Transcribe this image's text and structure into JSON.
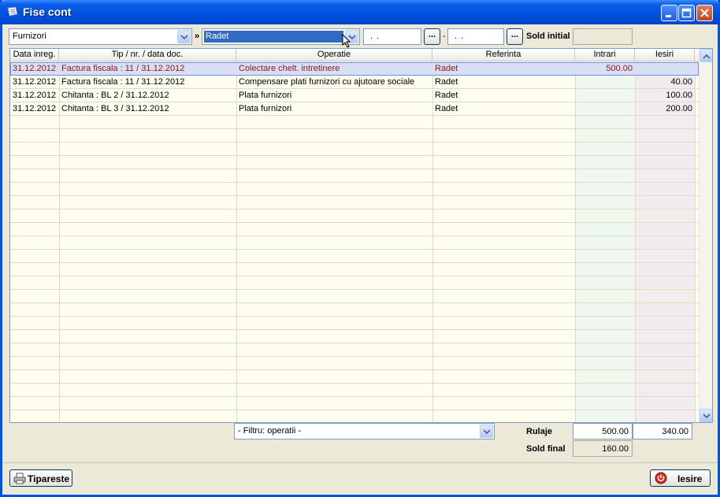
{
  "window": {
    "title": "Fise cont"
  },
  "filters": {
    "account_type": "Furnizori",
    "separator": "»",
    "partner": "Radet",
    "date_from": ". .",
    "date_to": ". .",
    "date_dash": "-",
    "date_btn": "...",
    "sold_initial_label": "Sold initial",
    "sold_initial_value": ""
  },
  "grid": {
    "columns": [
      "Data inreg.",
      "Tip / nr. / data doc.",
      "Operatie",
      "Referinta",
      "Intrari",
      "Iesiri"
    ],
    "rows": [
      {
        "date": "31.12.2012",
        "doc": "Factura fiscala : 11 / 31.12.2012",
        "op": "Colectare chelt. intretinere",
        "ref": "Radet",
        "in": "500.00",
        "out": ""
      },
      {
        "date": "31.12.2012",
        "doc": "Factura fiscala : 11 / 31.12.2012",
        "op": "Compensare plati furnizori cu ajutoare sociale",
        "ref": "Radet",
        "in": "",
        "out": "40.00"
      },
      {
        "date": "31.12.2012",
        "doc": "Chitanta : BL 2 / 31.12.2012",
        "op": "Plata furnizori",
        "ref": "Radet",
        "in": "",
        "out": "100.00"
      },
      {
        "date": "31.12.2012",
        "doc": "Chitanta : BL 3 / 31.12.2012",
        "op": "Plata furnizori",
        "ref": "Radet",
        "in": "",
        "out": "200.00"
      }
    ]
  },
  "footer": {
    "filter_combo": "- Filtru: operatii -",
    "rulaje_label": "Rulaje",
    "rulaje_in": "500.00",
    "rulaje_out": "340.00",
    "sold_final_label": "Sold final",
    "sold_final_value": "160.00",
    "print_label": "Tipareste",
    "exit_label": "Iesire"
  },
  "colors": {
    "selected_text": "#8b1a1a",
    "intrari_bg": "#eef8ee",
    "iesiri_bg": "#f3ecee",
    "grid_bg": "#fdfdf0"
  }
}
